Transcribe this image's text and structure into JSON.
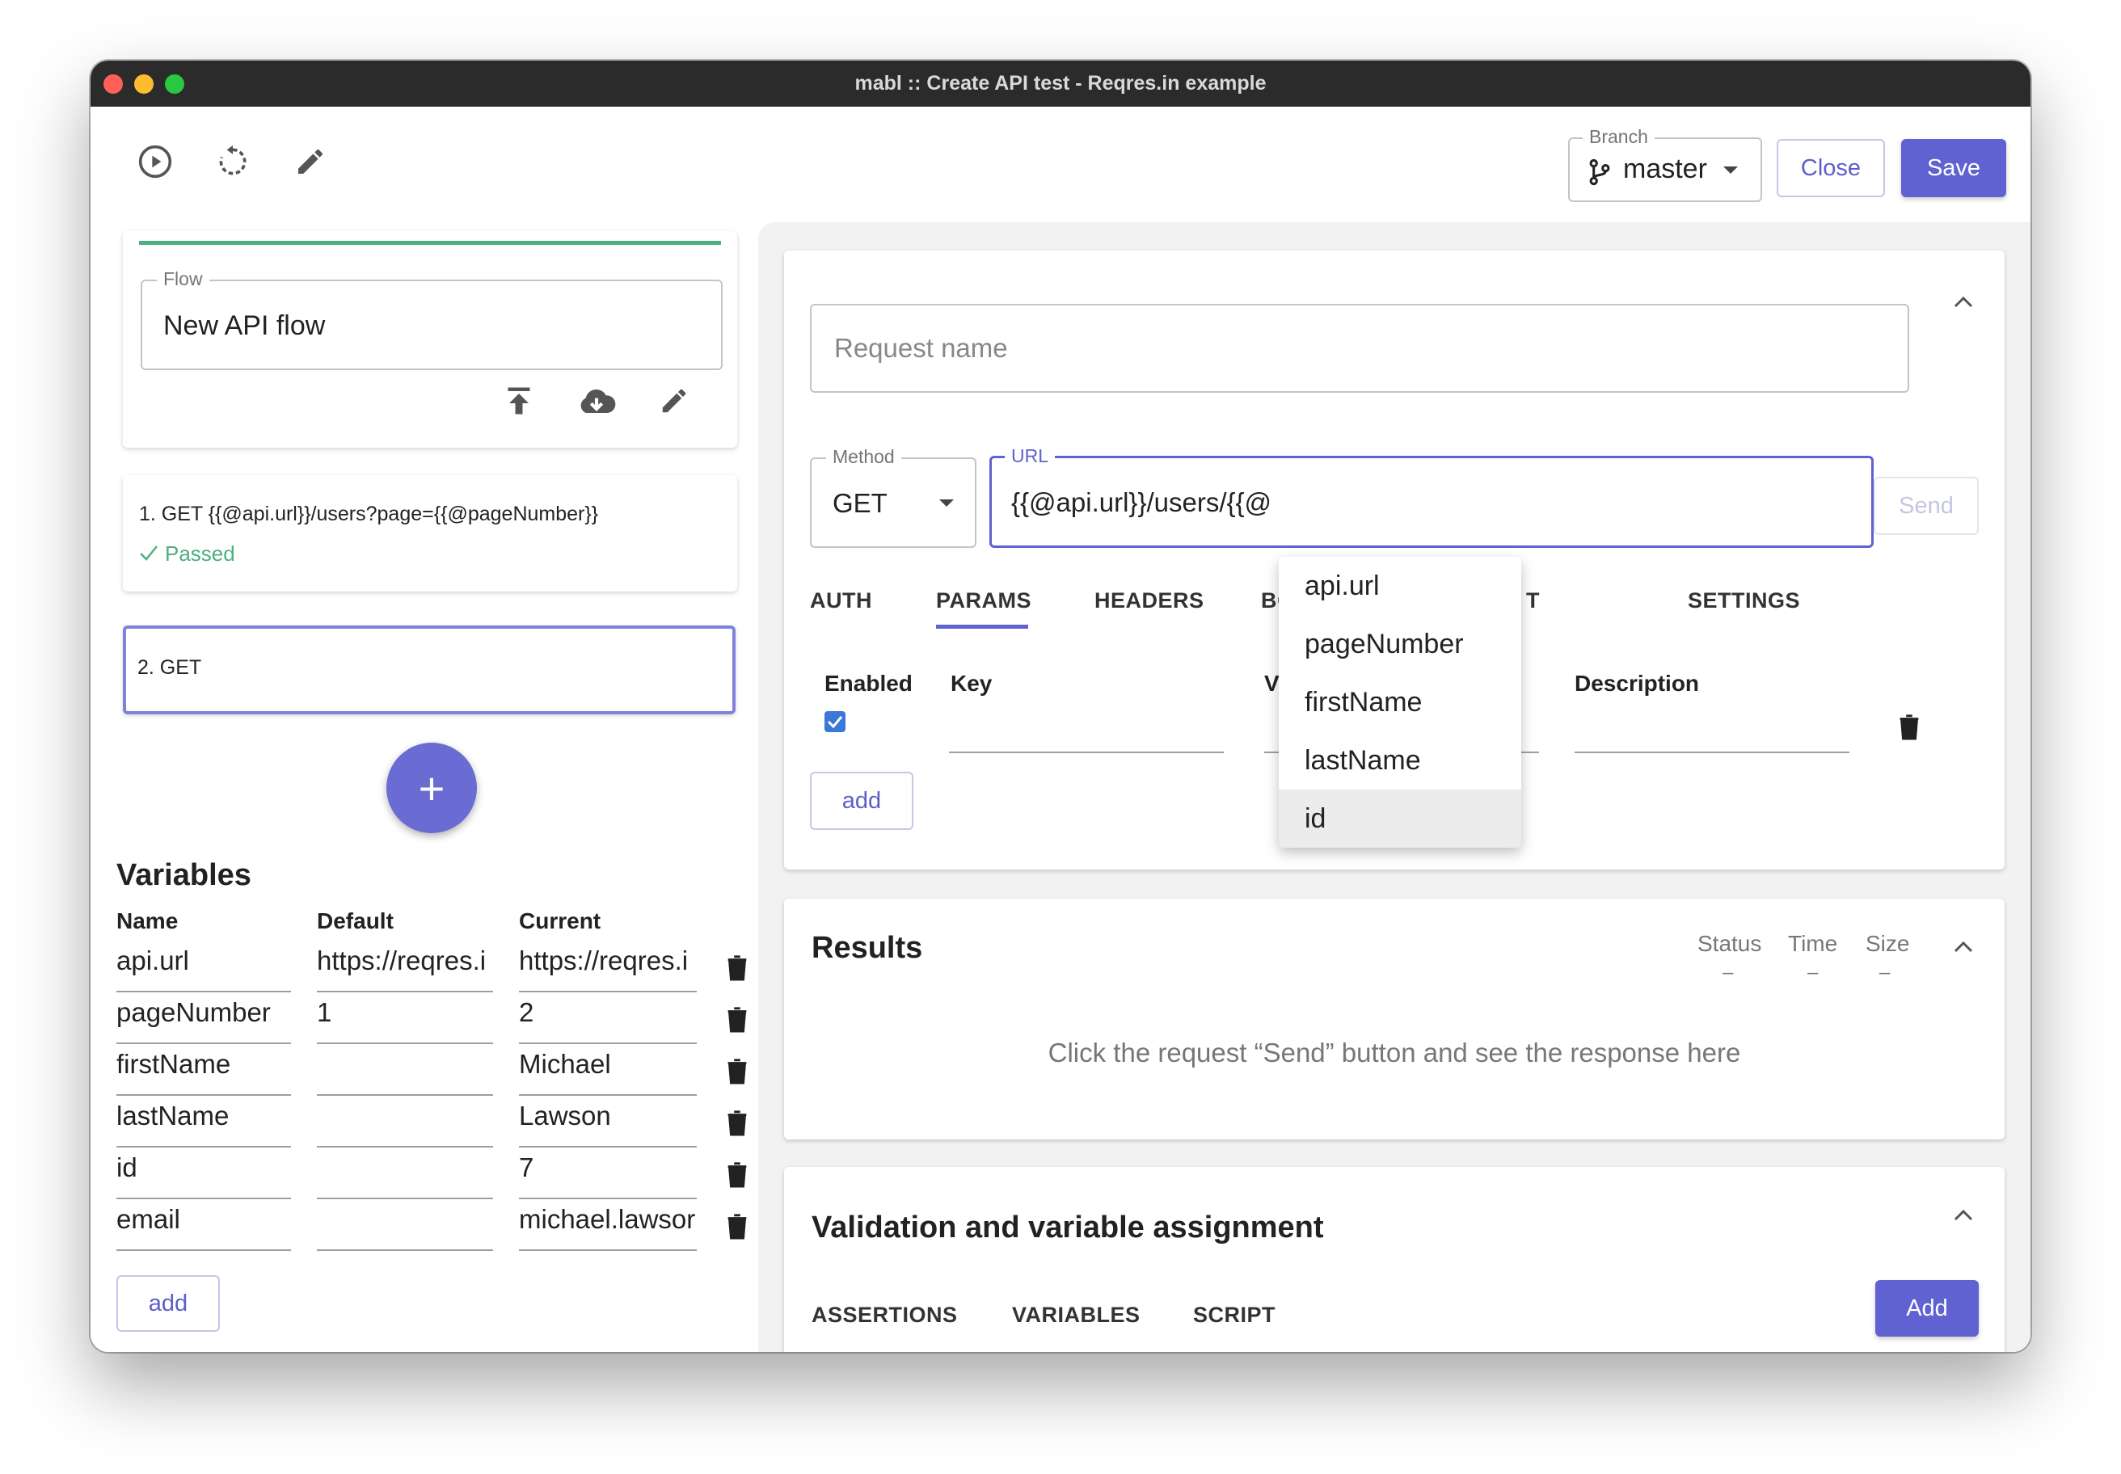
{
  "window": {
    "title": "mabl :: Create API test - Reqres.in example"
  },
  "colors": {
    "accent": "#5f62d0",
    "success": "#4caf82",
    "close_red": "#ff5f57",
    "min_yellow": "#febc2e",
    "max_green": "#28c840"
  },
  "toolbar": {
    "icons": [
      "play-circle-icon",
      "refresh-icon",
      "pencil-icon"
    ],
    "branch_label": "Branch",
    "branch_value": "master",
    "close_label": "Close",
    "save_label": "Save"
  },
  "flow": {
    "label": "Flow",
    "value": "New API flow",
    "actions": [
      "upload-icon",
      "cloud-download-icon",
      "pencil-icon"
    ]
  },
  "steps": [
    {
      "title": "1. GET {{@api.url}}/users?page={{@pageNumber}}",
      "status": "Passed"
    },
    {
      "title": "2. GET",
      "status": ""
    }
  ],
  "add_step_label": "+",
  "variables": {
    "heading": "Variables",
    "columns": [
      "Name",
      "Default",
      "Current"
    ],
    "rows": [
      {
        "name": "api.url",
        "default": "https://reqres.i",
        "current": "https://reqres.i"
      },
      {
        "name": "pageNumber",
        "default": "1",
        "current": "2"
      },
      {
        "name": "firstName",
        "default": "",
        "current": "Michael"
      },
      {
        "name": "lastName",
        "default": "",
        "current": "Lawson"
      },
      {
        "name": "id",
        "default": "",
        "current": "7"
      },
      {
        "name": "email",
        "default": "",
        "current": "michael.lawsor"
      }
    ],
    "add_label": "add"
  },
  "request": {
    "name_placeholder": "Request name",
    "method_label": "Method",
    "method_value": "GET",
    "url_label": "URL",
    "url_value": "{{@api.url}}/users/{{@",
    "send_label": "Send",
    "tabs": [
      "AUTH",
      "PARAMS",
      "HEADERS",
      "BO",
      "T",
      "SETTINGS"
    ],
    "active_tab": "PARAMS",
    "params_columns": {
      "enabled": "Enabled",
      "key": "Key",
      "value": "V",
      "description": "Description"
    },
    "add_label": "add"
  },
  "autocomplete": {
    "options": [
      "api.url",
      "pageNumber",
      "firstName",
      "lastName",
      "id"
    ],
    "highlighted": "id"
  },
  "results": {
    "heading": "Results",
    "status_label": "Status",
    "time_label": "Time",
    "size_label": "Size",
    "status_value": "–",
    "time_value": "–",
    "size_value": "–",
    "empty_message": "Click the request “Send” button and see the response here"
  },
  "validation": {
    "heading": "Validation and variable assignment",
    "tabs": [
      "ASSERTIONS",
      "VARIABLES",
      "SCRIPT"
    ],
    "add_label": "Add"
  }
}
